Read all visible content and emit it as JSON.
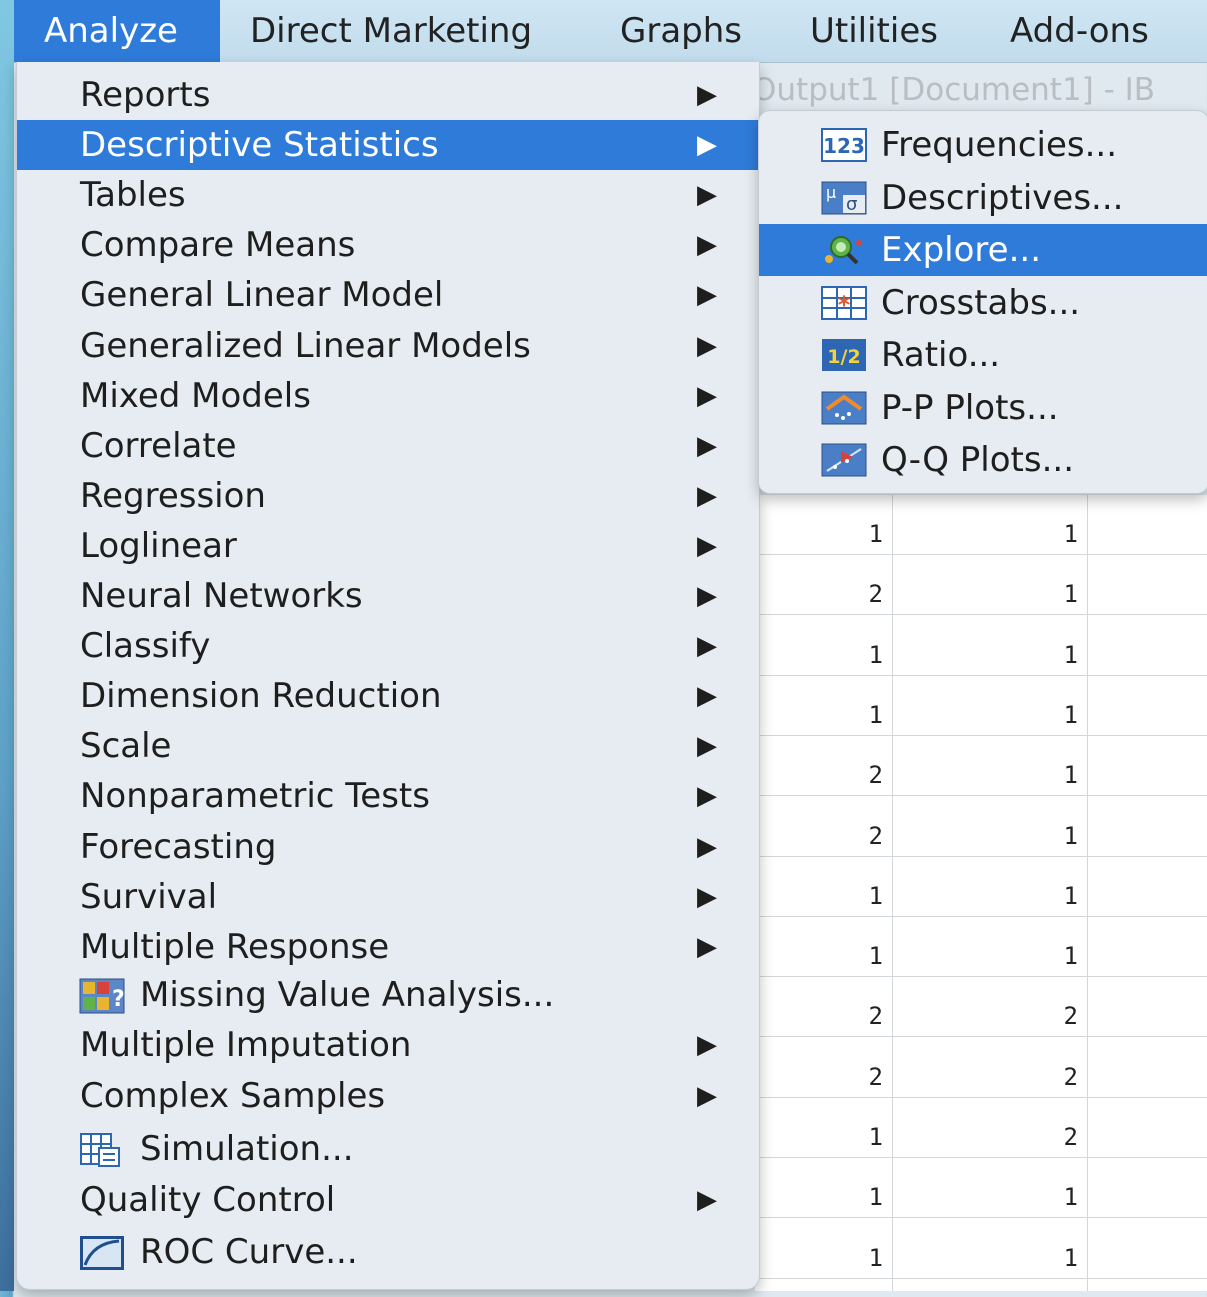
{
  "menubar": {
    "items": [
      {
        "label": "Analyze",
        "active": true
      },
      {
        "label": "Direct Marketing"
      },
      {
        "label": "Graphs"
      },
      {
        "label": "Utilities"
      },
      {
        "label": "Add-ons"
      }
    ]
  },
  "background": {
    "window_title": "Output1 [Document1] - IB",
    "grid_rows": [
      [
        "1",
        "1"
      ],
      [
        "2",
        "1"
      ],
      [
        "1",
        "1"
      ],
      [
        "1",
        "1"
      ],
      [
        "2",
        "1"
      ],
      [
        "2",
        "1"
      ],
      [
        "1",
        "1"
      ],
      [
        "1",
        "1"
      ],
      [
        "2",
        "2"
      ],
      [
        "2",
        "2"
      ],
      [
        "1",
        "2"
      ],
      [
        "1",
        "1"
      ],
      [
        "1",
        "1"
      ]
    ]
  },
  "analyze_menu": {
    "items": [
      {
        "label": "Reports",
        "submenu": true
      },
      {
        "label": "Descriptive Statistics",
        "submenu": true,
        "selected": true
      },
      {
        "label": "Tables",
        "submenu": true
      },
      {
        "label": "Compare Means",
        "submenu": true
      },
      {
        "label": "General Linear Model",
        "submenu": true
      },
      {
        "label": "Generalized Linear Models",
        "submenu": true
      },
      {
        "label": "Mixed Models",
        "submenu": true
      },
      {
        "label": "Correlate",
        "submenu": true
      },
      {
        "label": "Regression",
        "submenu": true
      },
      {
        "label": "Loglinear",
        "submenu": true
      },
      {
        "label": "Neural Networks",
        "submenu": true
      },
      {
        "label": "Classify",
        "submenu": true
      },
      {
        "label": "Dimension Reduction",
        "submenu": true
      },
      {
        "label": "Scale",
        "submenu": true
      },
      {
        "label": "Nonparametric Tests",
        "submenu": true
      },
      {
        "label": "Forecasting",
        "submenu": true
      },
      {
        "label": "Survival",
        "submenu": true
      },
      {
        "label": "Multiple Response",
        "submenu": true
      },
      {
        "label": "Missing Value Analysis...",
        "icon": "missing-value-icon"
      },
      {
        "label": "Multiple Imputation",
        "submenu": true
      },
      {
        "label": "Complex Samples",
        "submenu": true
      },
      {
        "label": "Simulation...",
        "icon": "simulation-icon"
      },
      {
        "label": "Quality Control",
        "submenu": true
      },
      {
        "label": "ROC Curve...",
        "icon": "roc-curve-icon"
      }
    ],
    "arrow_glyph": "▶"
  },
  "descriptive_submenu": {
    "items": [
      {
        "label": "Frequencies...",
        "icon": "frequencies-icon",
        "icon_text": "123"
      },
      {
        "label": "Descriptives...",
        "icon": "descriptives-icon",
        "icon_text": "μσ"
      },
      {
        "label": "Explore...",
        "icon": "explore-icon",
        "selected": true
      },
      {
        "label": "Crosstabs...",
        "icon": "crosstabs-icon"
      },
      {
        "label": "Ratio...",
        "icon": "ratio-icon",
        "icon_text": "1/2"
      },
      {
        "label": "P-P Plots...",
        "icon": "pp-plots-icon"
      },
      {
        "label": "Q-Q Plots...",
        "icon": "qq-plots-icon"
      }
    ]
  },
  "colors": {
    "selection": "#2f7bd9",
    "menu_bg": "#e6ecf1",
    "menubar_bg": "#c8e0f0"
  }
}
